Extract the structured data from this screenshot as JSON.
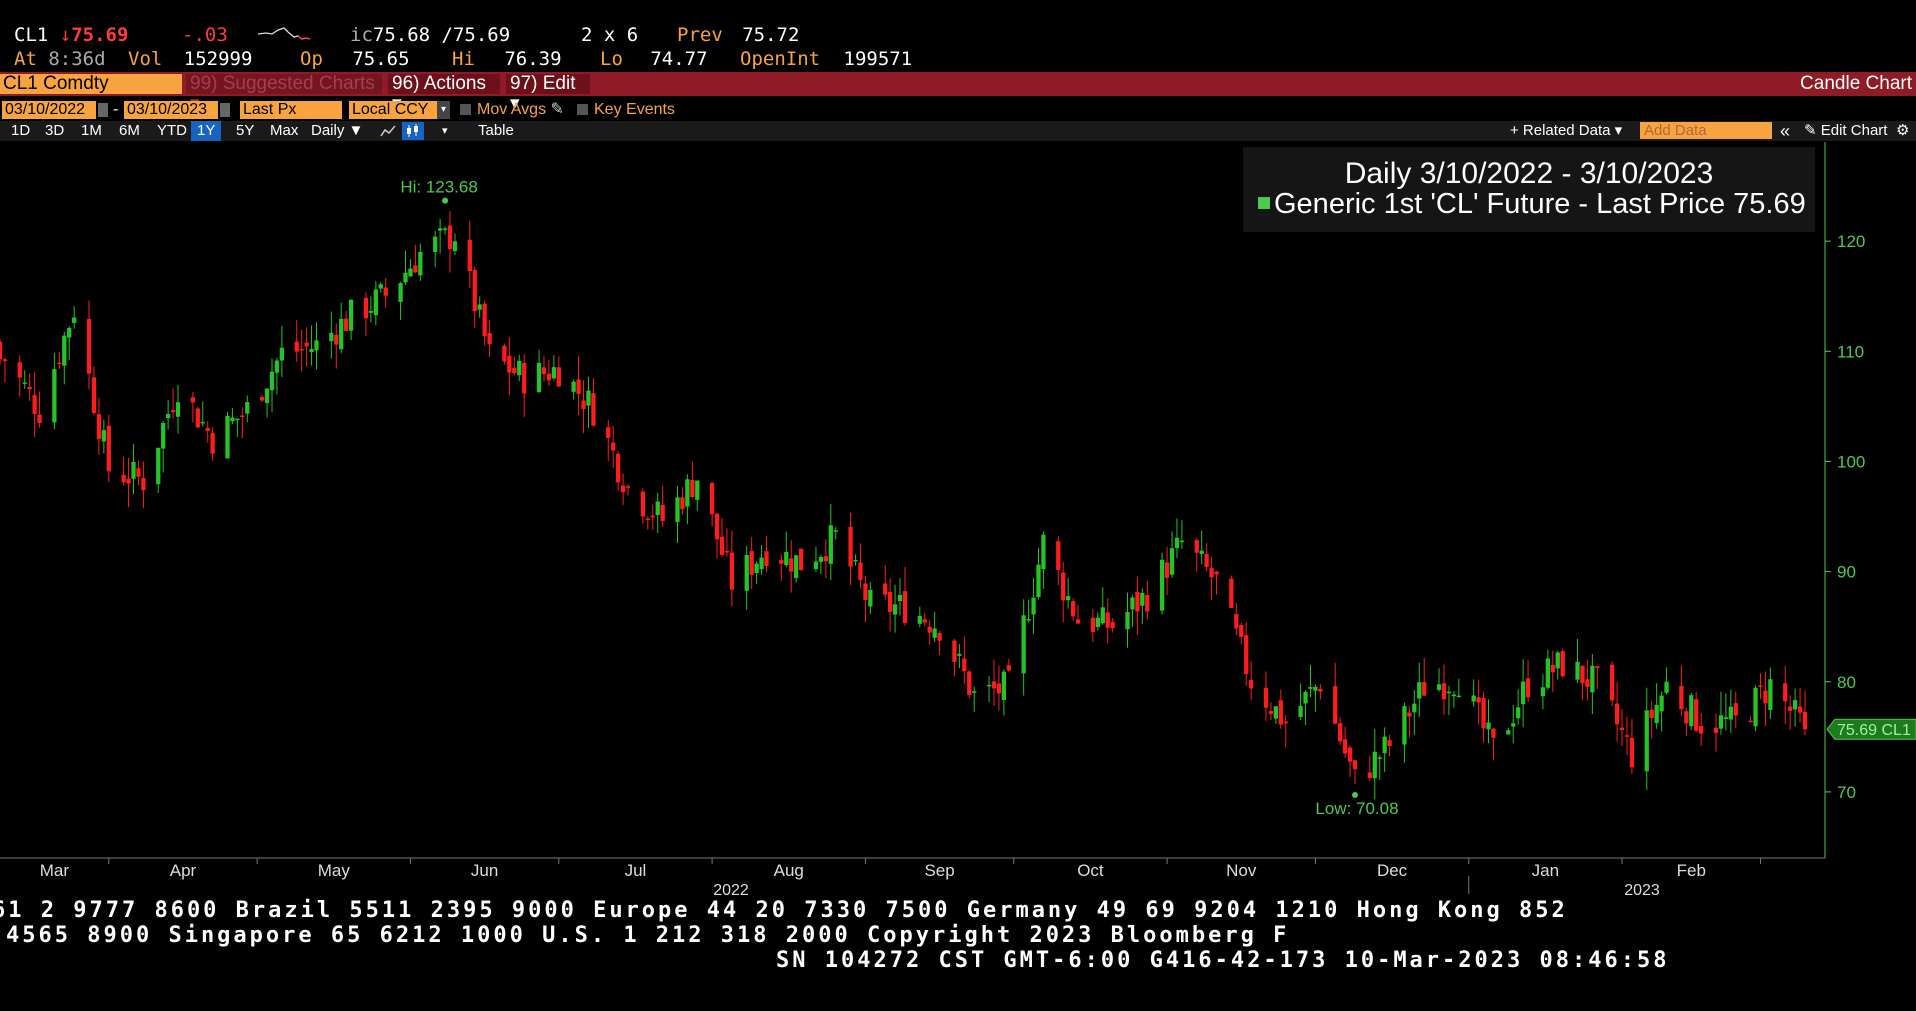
{
  "header": {
    "ticker": "CL1",
    "arrow": "↓",
    "last": "75.69",
    "change": "-.03",
    "ic_label": "ic",
    "bid_ask": "75.68 /75.69",
    "size": "2 x 6",
    "prev_label": "Prev",
    "prev_value": "75.72",
    "at_label": "At",
    "at_value": "8:36d",
    "vol_label": "Vol",
    "vol_value": "152999",
    "op_label": "Op",
    "op_value": "75.65",
    "hi_label": "Hi",
    "hi_value": "76.39",
    "lo_label": "Lo",
    "lo_value": "74.77",
    "oi_label": "OpenInt",
    "oi_value": "199571"
  },
  "menubar": {
    "security": "CL1 Comdty",
    "suggested": "99) Suggested Charts ▾",
    "actions": "96) Actions ▾",
    "edit": "97) Edit ▾",
    "chart_type": "Candle Chart"
  },
  "options": {
    "start_date": "03/10/2022",
    "dash": "-",
    "end_date": "03/10/2023",
    "field": "Last Px",
    "currency": "Local CCY",
    "mov_avgs": "Mov Avgs",
    "key_events": "Key Events"
  },
  "toolbar": {
    "ranges": [
      "1D",
      "3D",
      "1M",
      "6M",
      "YTD",
      "1Y",
      "5Y",
      "Max"
    ],
    "selected_range": "1Y",
    "period": "Daily ▼",
    "table": "Table",
    "related_data": "+ Related Data ▾",
    "add_data_placeholder": "Add Data",
    "collapse": "«",
    "edit_chart": "Edit Chart"
  },
  "chart_data": {
    "type": "candlestick",
    "title": "Daily 3/10/2022 - 3/10/2023",
    "series_label": "Generic 1st 'CL' Future - Last Price",
    "series_last": "75.69",
    "last_tag": "75.69 CL1",
    "hi_label": "Hi: 123.68",
    "low_label": "Low: 70.08",
    "hi_value": 123.68,
    "low_value": 70.08,
    "ylim": [
      64,
      129
    ],
    "yticks": [
      70,
      80,
      90,
      100,
      110,
      120
    ],
    "x_months": [
      "Mar",
      "Apr",
      "May",
      "Jun",
      "Jul",
      "Aug",
      "Sep",
      "Oct",
      "Nov",
      "Dec",
      "Jan",
      "Feb"
    ],
    "x_years": [
      "2022",
      "2023"
    ],
    "close_series_weekly": [
      [
        "2022-03-11",
        109.3
      ],
      [
        "2022-03-18",
        104.7
      ],
      [
        "2022-03-25",
        113.9
      ],
      [
        "2022-04-01",
        99.3
      ],
      [
        "2022-04-08",
        98.3
      ],
      [
        "2022-04-15",
        106.9
      ],
      [
        "2022-04-22",
        102.1
      ],
      [
        "2022-04-29",
        104.7
      ],
      [
        "2022-05-06",
        109.8
      ],
      [
        "2022-05-13",
        110.5
      ],
      [
        "2022-05-20",
        113.2
      ],
      [
        "2022-05-27",
        115.1
      ],
      [
        "2022-06-03",
        118.9
      ],
      [
        "2022-06-10",
        120.7
      ],
      [
        "2022-06-17",
        109.6
      ],
      [
        "2022-06-24",
        107.6
      ],
      [
        "2022-07-01",
        108.4
      ],
      [
        "2022-07-08",
        104.8
      ],
      [
        "2022-07-15",
        97.6
      ],
      [
        "2022-07-22",
        94.7
      ],
      [
        "2022-07-29",
        98.6
      ],
      [
        "2022-08-05",
        89.0
      ],
      [
        "2022-08-12",
        92.1
      ],
      [
        "2022-08-19",
        90.8
      ],
      [
        "2022-08-26",
        93.1
      ],
      [
        "2022-09-02",
        86.9
      ],
      [
        "2022-09-09",
        86.8
      ],
      [
        "2022-09-16",
        85.1
      ],
      [
        "2022-09-23",
        78.7
      ],
      [
        "2022-09-30",
        79.5
      ],
      [
        "2022-10-07",
        92.6
      ],
      [
        "2022-10-14",
        85.6
      ],
      [
        "2022-10-21",
        85.1
      ],
      [
        "2022-10-28",
        87.9
      ],
      [
        "2022-11-04",
        92.6
      ],
      [
        "2022-11-11",
        89.0
      ],
      [
        "2022-11-18",
        80.1
      ],
      [
        "2022-11-25",
        76.3
      ],
      [
        "2022-12-02",
        80.0
      ],
      [
        "2022-12-09",
        71.0
      ],
      [
        "2022-12-16",
        74.3
      ],
      [
        "2022-12-23",
        79.6
      ],
      [
        "2022-12-30",
        80.3
      ],
      [
        "2023-01-06",
        73.8
      ],
      [
        "2023-01-13",
        79.9
      ],
      [
        "2023-01-20",
        81.6
      ],
      [
        "2023-01-27",
        79.7
      ],
      [
        "2023-02-03",
        73.4
      ],
      [
        "2023-02-10",
        79.7
      ],
      [
        "2023-02-17",
        76.3
      ],
      [
        "2023-02-24",
        76.3
      ],
      [
        "2023-03-03",
        79.7
      ],
      [
        "2023-03-10",
        75.69
      ]
    ]
  },
  "footer": {
    "line1": "61 2 9777 8600 Brazil 5511 2395 9000 Europe 44 20 7330 7500 Germany 49 69 9204 1210 Hong Kong 852",
    "line2": "4565 8900       Singapore 65 6212 1000       U.S. 1 212 318 2000       Copyright 2023 Bloomberg F",
    "line3": "SN 104272 CST  GMT-6:00 G416-42-173 10-Mar-2023 08:46:58"
  },
  "colors": {
    "up": "#23c423",
    "down": "#ff1c1c",
    "axis": "#4ec94e",
    "accent": "#f7a340",
    "bar": "#8e1b25"
  }
}
